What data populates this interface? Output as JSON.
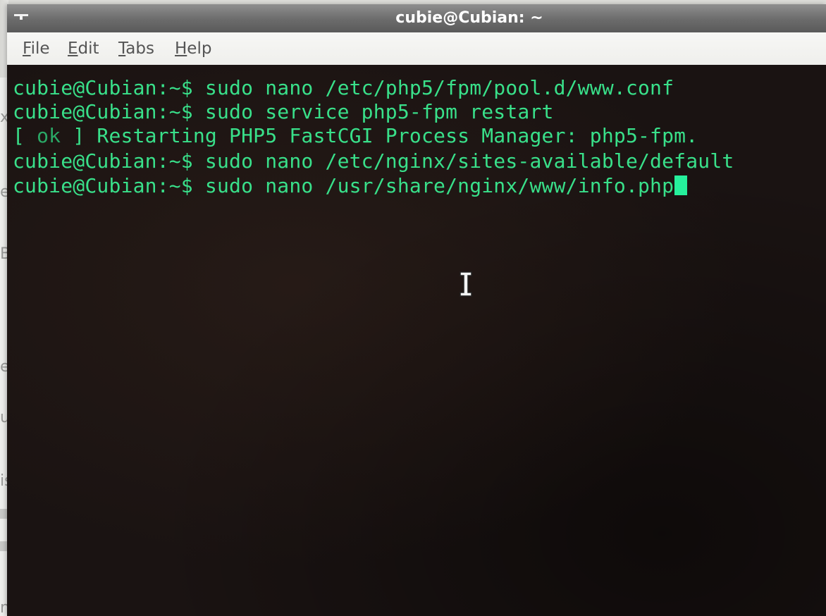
{
  "window": {
    "title": "cubie@Cubian: ~"
  },
  "menu": {
    "items": [
      "File",
      "Edit",
      "Tabs",
      "Help"
    ]
  },
  "terminal": {
    "lines": [
      {
        "prompt": "cubie@Cubian:~$",
        "command": " sudo nano /etc/php5/fpm/pool.d/www.conf"
      },
      {
        "prompt": "cubie@Cubian:~$",
        "command": " sudo service php5-fpm restart"
      },
      {
        "status_open": "[",
        "status": " ok ",
        "status_close": "]",
        "message": " Restarting PHP5 FastCGI Process Manager: php5-fpm."
      },
      {
        "prompt": "cubie@Cubian:~$",
        "command": " sudo nano /etc/nginx/sites-available/default"
      },
      {
        "prompt": "cubie@Cubian:~$",
        "command": " sudo nano /usr/share/nginx/www/info.php"
      }
    ]
  },
  "background_fragments": [
    "x",
    "e",
    "B",
    "ev",
    "ui",
    "is",
    "ne"
  ],
  "colors": {
    "terminal_text": "#39e08a",
    "terminal_bg": "#1a1312",
    "cursor": "#26f09c"
  },
  "icons": {
    "window_menu": "window-menu-icon",
    "mouse_cursor": "ibeam-cursor-icon"
  }
}
